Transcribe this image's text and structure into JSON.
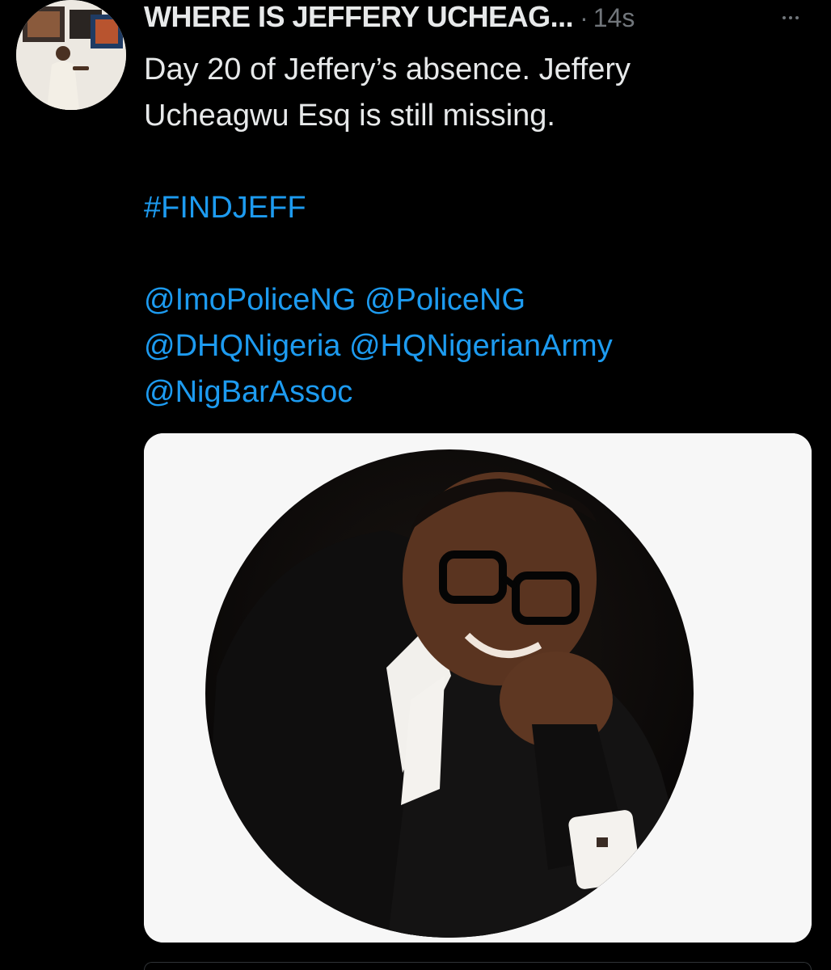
{
  "tweet": {
    "author": {
      "display_name": "WHERE IS JEFFERY UCHEAG...",
      "avatar_icon": "user-avatar"
    },
    "separator": "·",
    "time": "14s",
    "more_icon": "more-options-icon",
    "text_line1": "Day 20 of Jeffery’s absence. Jeffery",
    "text_line2": "Ucheagwu Esq is still missing.",
    "hashtag": "#FINDJEFF",
    "mentions": {
      "m1": "@ImoPoliceNG",
      "m2": "@PoliceNG",
      "m3": "@DHQNigeria",
      "m4": "@HQNigerianArmy",
      "m5": "@NigBarAssoc"
    },
    "media": {
      "kind": "photo"
    }
  },
  "colors": {
    "background": "#000000",
    "text": "#e7e9ea",
    "muted": "#71767b",
    "link": "#1d9bf0",
    "media_background": "#f7f7f7"
  }
}
